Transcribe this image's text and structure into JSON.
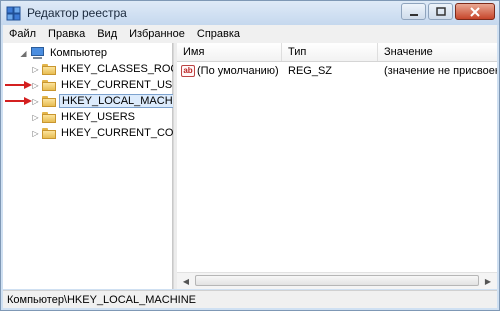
{
  "window": {
    "title": "Редактор реестра"
  },
  "menu": [
    "Файл",
    "Правка",
    "Вид",
    "Избранное",
    "Справка"
  ],
  "tree": {
    "root": "Компьютер",
    "items": [
      {
        "label": "HKEY_CLASSES_ROOT"
      },
      {
        "label": "HKEY_CURRENT_USER"
      },
      {
        "label": "HKEY_LOCAL_MACHINE"
      },
      {
        "label": "HKEY_USERS"
      },
      {
        "label": "HKEY_CURRENT_CONFIG"
      }
    ],
    "selected": "HKEY_LOCAL_MACHINE"
  },
  "list": {
    "columns": [
      "Имя",
      "Тип",
      "Значение"
    ],
    "rows": [
      {
        "name": "(По умолчанию)",
        "type": "REG_SZ",
        "value": "(значение не присвоено)"
      }
    ]
  },
  "status": {
    "path": "Компьютер\\HKEY_LOCAL_MACHINE"
  },
  "colors": {
    "arrow": "#d42020",
    "selection": "#dcebfc",
    "selection_border": "#7da2ce"
  }
}
